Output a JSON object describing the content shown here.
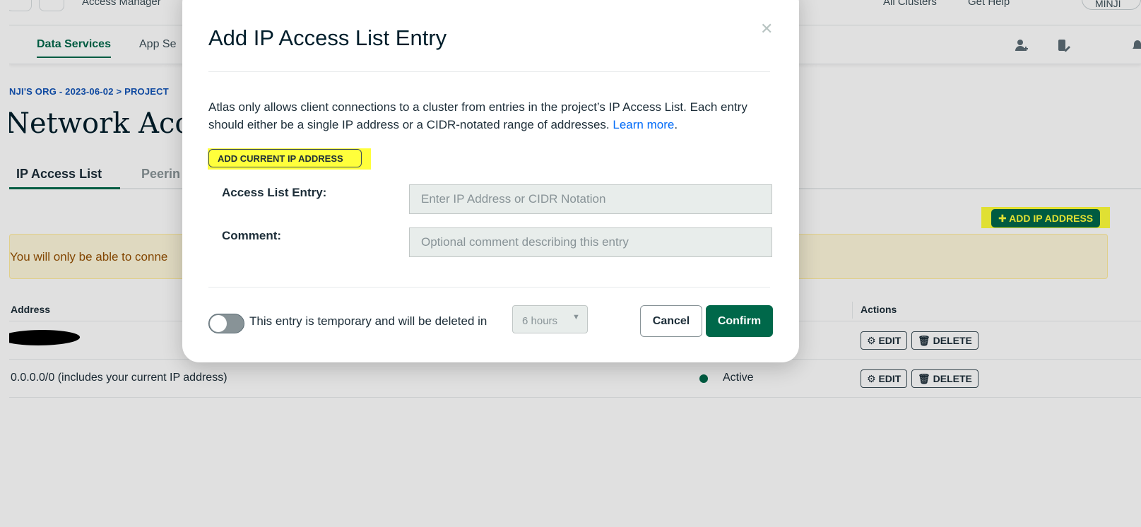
{
  "topbar": {
    "project_label": "Access Manager",
    "clusters_label": "All Clusters",
    "help_label": "Get Help",
    "user_label": "MINJI"
  },
  "subnav": {
    "active_tab": "Data Services",
    "second_tab": "App Se"
  },
  "page": {
    "org_breadcrumb": "NJI'S ORG - 2023-06-02 > PROJECT",
    "title": "Network Acce",
    "tabs": [
      "IP Access List",
      "Peerin"
    ],
    "add_ip_button": "ADD IP ADDRESS",
    "banner_text": "You will only be able to conne"
  },
  "table": {
    "headers": [
      "Address",
      "Actions"
    ],
    "rows": [
      {
        "address": "",
        "status": "",
        "edit": "EDIT",
        "delete": "DELETE"
      },
      {
        "address": "0.0.0.0/0  (includes your current IP address)",
        "status": "Active",
        "edit": "EDIT",
        "delete": "DELETE"
      }
    ]
  },
  "modal": {
    "title": "Add IP Access List Entry",
    "description": "Atlas only allows client connections to a cluster from entries in the project’s IP Access List. Each entry should either be a single IP address or a CIDR-notated range of addresses.",
    "learn_more": "Learn more",
    "add_current_ip": "ADD CURRENT IP ADDRESS",
    "access_label": "Access List Entry:",
    "access_placeholder": "Enter IP Address or CIDR Notation",
    "comment_label": "Comment:",
    "comment_placeholder": "Optional comment describing this entry",
    "temporary_text": "This entry is temporary and will be deleted in",
    "duration_value": "6 hours",
    "cancel": "Cancel",
    "confirm": "Confirm"
  },
  "colors": {
    "brand_green": "#00684a",
    "highlight": "#ffff3b",
    "link_blue": "#016bf8"
  }
}
